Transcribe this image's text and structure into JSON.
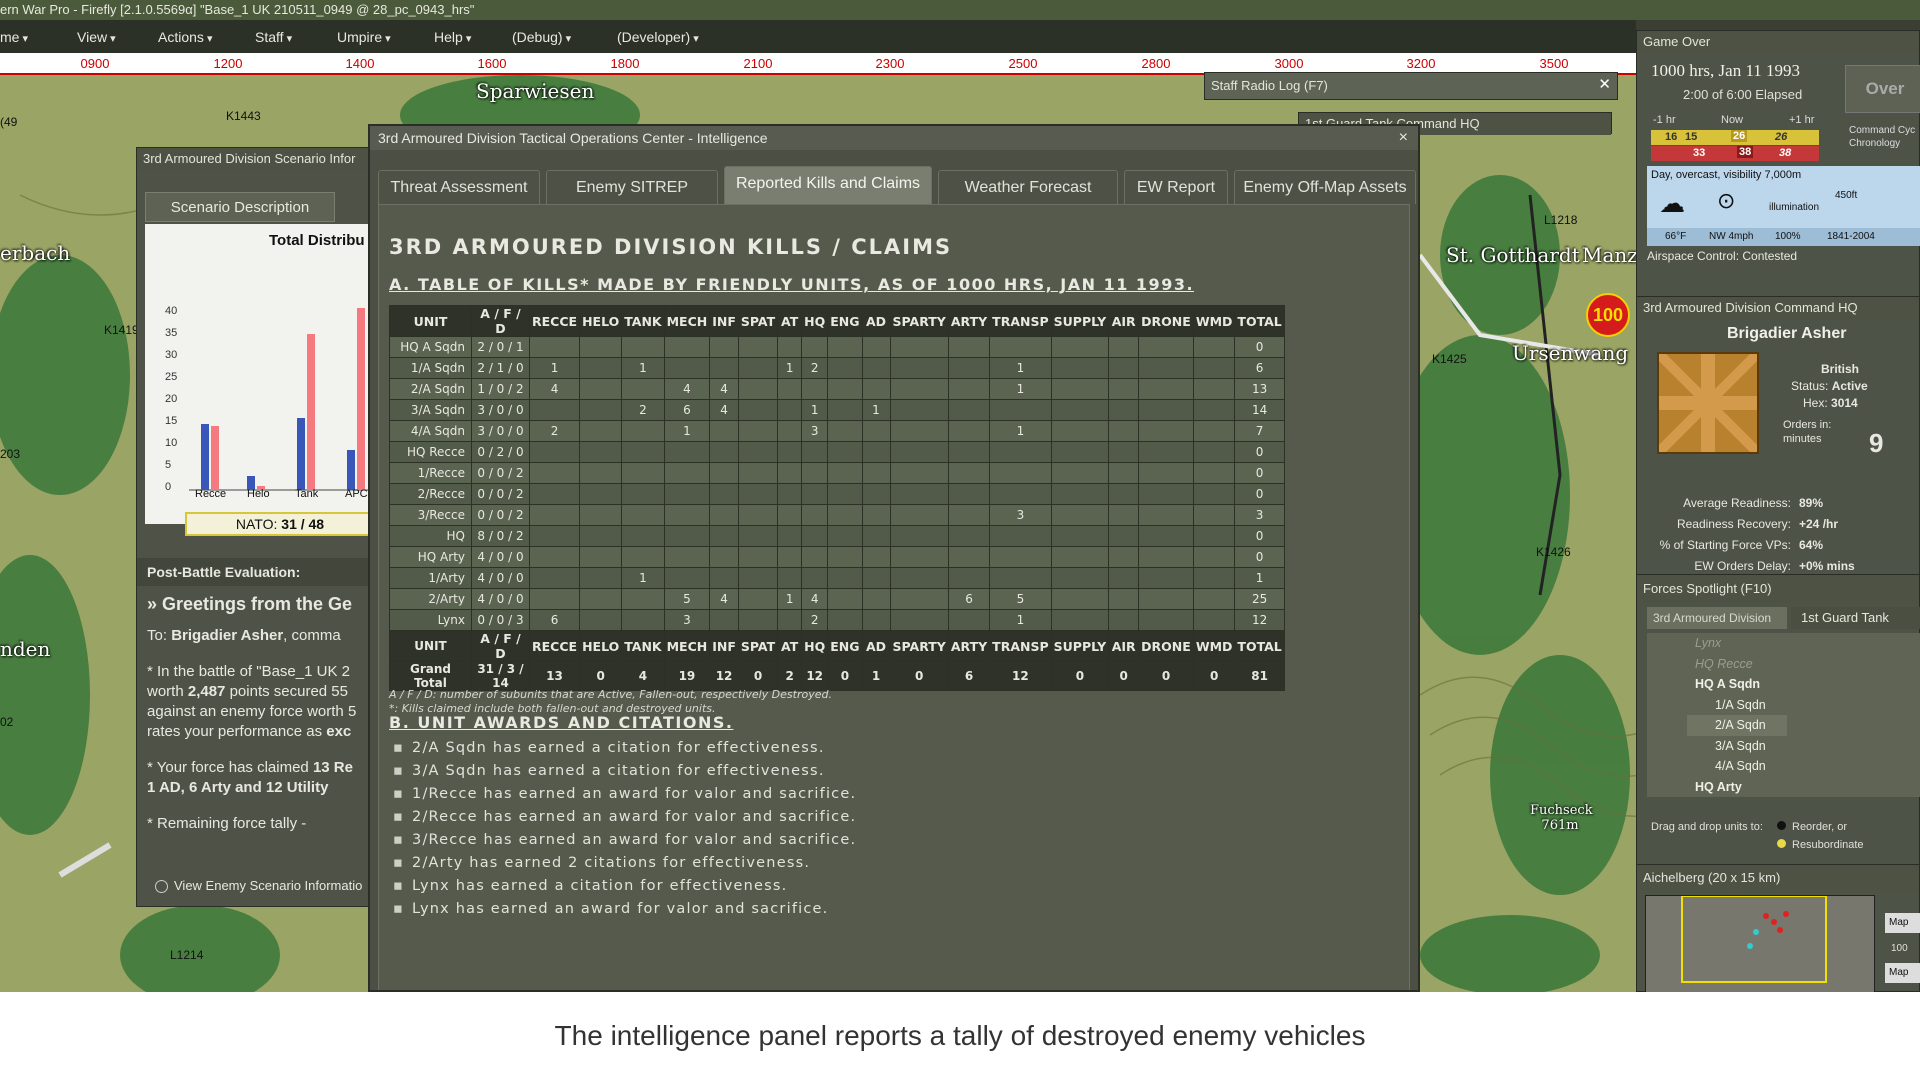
{
  "window": {
    "title": "ern War Pro - Firefly  [2.1.0.5569α]  \"Base_1 UK 210511_0949 @ 28_pc_0943_hrs\""
  },
  "menu": [
    "me",
    "View",
    "Actions",
    "Staff",
    "Umpire",
    "Help",
    "(Debug)",
    "(Developer)"
  ],
  "ruler": [
    "0900",
    "1200",
    "1400",
    "1600",
    "1800",
    "2100",
    "2300",
    "2500",
    "2800",
    "3000",
    "3200",
    "3500"
  ],
  "map": {
    "places": [
      "Sparwiesen",
      "erbach",
      "St. Gotthardt",
      "Manze",
      "Ursenwang",
      "nden",
      "Fuchseck 761m"
    ],
    "refs": [
      "K1443",
      "K1419",
      "203",
      "02",
      "L1214",
      "L1218",
      "K1425",
      "K1426",
      "(49"
    ],
    "unit_badge": "100"
  },
  "radio": {
    "title": "Staff Radio Log   (F7)",
    "sub": "1st Guard Tank Command HQ"
  },
  "scenario": {
    "title": "3rd Armoured Division Scenario Infor",
    "tab": "Scenario Description",
    "chart_title": "Total Distribu",
    "yticks": [
      "40",
      "35",
      "30",
      "25",
      "20",
      "15",
      "10",
      "5",
      "0"
    ],
    "xcats": [
      "Recce",
      "Helo",
      "Tank",
      "APC"
    ],
    "nato_label": "NATO:",
    "nato_value": "31 / 48",
    "section": "Post-Battle Evaluation:",
    "greet": "» Greetings from the Ge",
    "to_prefix": "To:",
    "to_name": "Brigadier Asher",
    "to_suffix": ", comma",
    "p1": "* In the battle of \"Base_1 UK 2",
    "p2a": "worth",
    "p2b": "2,487",
    "p2c": "points secured 55",
    "p3": "against an enemy force worth 5",
    "p4a": "rates your performance as",
    "p4b": "exc",
    "p5a": "* Your force has claimed",
    "p5b": "13 Re",
    "p6": "1 AD, 6 Arty and 12 Utility",
    "p7": "* Remaining force tally -",
    "view_enemy": "View Enemy Scenario Informatio"
  },
  "intel": {
    "title": "3rd Armoured Division Tactical Operations Center - Intelligence",
    "close": "×",
    "tabs": [
      "Threat Assessment",
      "Enemy SITREP",
      "Reported Kills and Claims",
      "Weather Forecast",
      "EW Report",
      "Enemy Off-Map Assets"
    ],
    "heading": "3RD ARMOURED DIVISION KILLS / CLAIMS",
    "sectionA": "A. TABLE OF KILLS* MADE BY FRIENDLY UNITS, AS OF 1000 HRS, JAN 11 1993.",
    "columns": [
      "UNIT",
      "A / F / D",
      "RECCE",
      "HELO",
      "TANK",
      "MECH",
      "INF",
      "SPAT",
      "AT",
      "HQ",
      "ENG",
      "AD",
      "SPARTY",
      "ARTY",
      "TRANSP",
      "SUPPLY",
      "AIR",
      "DRONE",
      "WMD",
      "TOTAL"
    ],
    "rows": [
      [
        "HQ A Sqdn",
        "2 / 0 / 1",
        "",
        "",
        "",
        "",
        "",
        "",
        "",
        "",
        "",
        "",
        "",
        "",
        "",
        "",
        "",
        "",
        "",
        "0"
      ],
      [
        "1/A Sqdn",
        "2 / 1 / 0",
        "1",
        "",
        "1",
        "",
        "",
        "",
        "1",
        "2",
        "",
        "",
        "",
        "",
        "1",
        "",
        "",
        "",
        "",
        "6"
      ],
      [
        "2/A Sqdn",
        "1 / 0 / 2",
        "4",
        "",
        "",
        "4",
        "4",
        "",
        "",
        "",
        "",
        "",
        "",
        "",
        "1",
        "",
        "",
        "",
        "",
        "13"
      ],
      [
        "3/A Sqdn",
        "3 / 0 / 0",
        "",
        "",
        "2",
        "6",
        "4",
        "",
        "",
        "1",
        "",
        "1",
        "",
        "",
        "",
        "",
        "",
        "",
        "",
        "14"
      ],
      [
        "4/A Sqdn",
        "3 / 0 / 0",
        "2",
        "",
        "",
        "1",
        "",
        "",
        "",
        "3",
        "",
        "",
        "",
        "",
        "1",
        "",
        "",
        "",
        "",
        "7"
      ],
      [
        "HQ Recce",
        "0 / 2 / 0",
        "",
        "",
        "",
        "",
        "",
        "",
        "",
        "",
        "",
        "",
        "",
        "",
        "",
        "",
        "",
        "",
        "",
        "0"
      ],
      [
        "1/Recce",
        "0 / 0 / 2",
        "",
        "",
        "",
        "",
        "",
        "",
        "",
        "",
        "",
        "",
        "",
        "",
        "",
        "",
        "",
        "",
        "",
        "0"
      ],
      [
        "2/Recce",
        "0 / 0 / 2",
        "",
        "",
        "",
        "",
        "",
        "",
        "",
        "",
        "",
        "",
        "",
        "",
        "",
        "",
        "",
        "",
        "",
        "0"
      ],
      [
        "3/Recce",
        "0 / 0 / 2",
        "",
        "",
        "",
        "",
        "",
        "",
        "",
        "",
        "",
        "",
        "",
        "",
        "3",
        "",
        "",
        "",
        "",
        "3"
      ],
      [
        "HQ",
        "8 / 0 / 2",
        "",
        "",
        "",
        "",
        "",
        "",
        "",
        "",
        "",
        "",
        "",
        "",
        "",
        "",
        "",
        "",
        "",
        "0"
      ],
      [
        "HQ Arty",
        "4 / 0 / 0",
        "",
        "",
        "",
        "",
        "",
        "",
        "",
        "",
        "",
        "",
        "",
        "",
        "",
        "",
        "",
        "",
        "",
        "0"
      ],
      [
        "1/Arty",
        "4 / 0 / 0",
        "",
        "",
        "1",
        "",
        "",
        "",
        "",
        "",
        "",
        "",
        "",
        "",
        "",
        "",
        "",
        "",
        "",
        "1"
      ],
      [
        "2/Arty",
        "4 / 0 / 0",
        "",
        "",
        "",
        "5",
        "4",
        "",
        "1",
        "4",
        "",
        "",
        "",
        "6",
        "5",
        "",
        "",
        "",
        "",
        "25"
      ],
      [
        "Lynx",
        "0 / 0 / 3",
        "6",
        "",
        "",
        "3",
        "",
        "",
        "",
        "2",
        "",
        "",
        "",
        "",
        "1",
        "",
        "",
        "",
        "",
        "12"
      ]
    ],
    "grand_total": [
      "Grand Total",
      "31 / 3 / 14",
      "13",
      "0",
      "4",
      "19",
      "12",
      "0",
      "2",
      "12",
      "0",
      "1",
      "0",
      "6",
      "12",
      "0",
      "0",
      "0",
      "0",
      "81"
    ],
    "note1": "A / F / D: number of subunits that are Active, Fallen-out, respectively Destroyed.",
    "note2": "*: Kills claimed include both fallen-out and destroyed units.",
    "sectionB": "B. UNIT AWARDS AND CITATIONS.",
    "awards": [
      "2/A Sqdn has earned a citation for effectiveness.",
      "3/A Sqdn has earned a citation for effectiveness.",
      "1/Recce has earned an award for valor and sacrifice.",
      "2/Recce has earned an award for valor and sacrifice.",
      "3/Recce has earned an award for valor and sacrifice.",
      "2/Arty has earned 2 citations for effectiveness.",
      "Lynx has earned a citation for effectiveness.",
      "Lynx has earned an award for valor and sacrifice."
    ]
  },
  "gameover": {
    "title": "Game Over",
    "time": "1000 hrs, Jan 11 1993",
    "elapsed": "2:00 of 6:00 Elapsed",
    "minus": "-1 hr",
    "now": "Now",
    "plus": "+1 hr",
    "yellow": [
      "16",
      "15",
      "26",
      "26"
    ],
    "red": [
      "33",
      "38",
      "38"
    ],
    "over_btn": "Over",
    "cmd_cycle": "Command Cyc",
    "chronology": "Chronology"
  },
  "weather": {
    "desc": "Day, overcast, visibility 7,000m",
    "temp": "66°F",
    "wind": "NW 4mph",
    "illum_label": "illumination",
    "illum": "100%",
    "alt": "450ft",
    "times": "1841-2004",
    "airspace": "Airspace Control: Contested"
  },
  "hq": {
    "title": "3rd Armoured Division Command HQ",
    "name": "Brigadier Asher",
    "nation": "British",
    "status_label": "Status:",
    "status": "Active",
    "hex_label": "Hex:",
    "hex": "3014",
    "orders_label": "Orders in: minutes",
    "orders": "9",
    "readiness_label": "Average Readiness:",
    "readiness": "89%",
    "recovery_label": "Readiness Recovery:",
    "recovery": "+24 /hr",
    "vps_label": "% of Starting Force VPs:",
    "vps": "64%",
    "ew_label": "EW Orders Delay:",
    "ew": "+0% mins"
  },
  "forces": {
    "title": "Forces Spotlight   (F10)",
    "tabs": [
      "3rd Armoured Division",
      "1st Guard Tank"
    ],
    "items": [
      "Lynx",
      "HQ Recce",
      "HQ A Sqdn",
      "1/A Sqdn",
      "2/A Sqdn",
      "3/A Sqdn",
      "4/A Sqdn",
      "HQ Arty"
    ],
    "drag": "Drag and drop units to:",
    "reorder": "Reorder, or",
    "resub": "Resubordinate"
  },
  "minimap": {
    "title": "Aichelberg (20 x 15 km)",
    "btn1": "Map",
    "btn2": "100",
    "btn3": "Map"
  },
  "caption": "The intelligence panel reports a tally of destroyed enemy vehicles"
}
